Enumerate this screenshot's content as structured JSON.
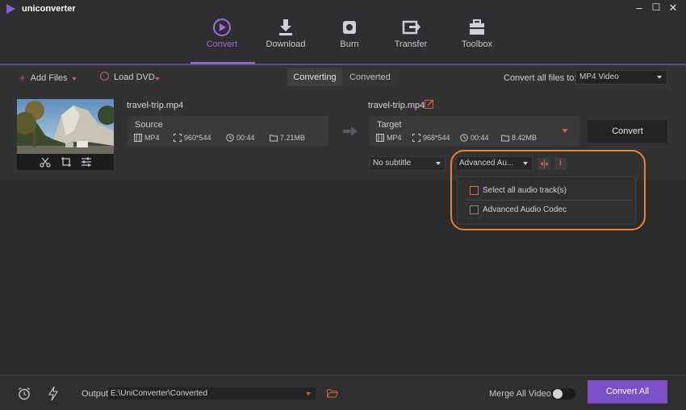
{
  "app": {
    "name": "uniconverter"
  },
  "window_controls": {
    "minimize": "–",
    "maximize": "☐",
    "close": "✕"
  },
  "nav": {
    "active": "Convert",
    "tabs": [
      {
        "label": "Convert",
        "icon": "convert-icon"
      },
      {
        "label": "Download",
        "icon": "download-icon"
      },
      {
        "label": "Burn",
        "icon": "burn-icon"
      },
      {
        "label": "Transfer",
        "icon": "transfer-icon"
      },
      {
        "label": "Toolbox",
        "icon": "toolbox-icon"
      }
    ]
  },
  "toolbar": {
    "add_files": "Add Files",
    "load_dvd": "Load DVD",
    "segments": [
      "Converting",
      "Converted"
    ],
    "convert_all_to_label": "Convert all files to:",
    "convert_all_to_value": "MP4 Video"
  },
  "file": {
    "source_name": "travel-trip.mp4",
    "target_name": "travel-trip.mp4",
    "source": {
      "label": "Source",
      "format": "MP4",
      "resolution": "960*544",
      "duration": "00:44",
      "size": "7.21MB"
    },
    "target": {
      "label": "Target",
      "format": "MP4",
      "resolution": "968*544",
      "duration": "00:44",
      "size": "8.42MB"
    },
    "convert_button": "Convert",
    "subtitle": "No subtitle",
    "audio": "Advanced Au...",
    "audio_options": [
      {
        "label": "Select all audio track(s)",
        "checked": false
      },
      {
        "label": "Advanced Audio Codec",
        "checked": false
      }
    ]
  },
  "bottom": {
    "output_label": "Output",
    "output_path": "E:\\UniConverter\\Converted",
    "merge_label": "Merge All Videos",
    "merge_enabled": false,
    "convert_all_button": "Convert All"
  },
  "colors": {
    "accent": "#7b4fc6",
    "highlight": "#e8842e",
    "nav_active": "#9d6fd8"
  }
}
